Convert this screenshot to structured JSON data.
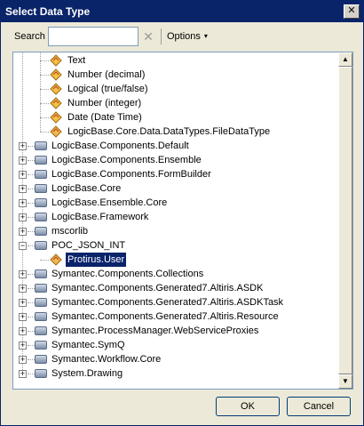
{
  "window": {
    "title": "Select Data Type",
    "close_glyph": "✕"
  },
  "toolbar": {
    "search_label": "Search",
    "search_value": "",
    "clear_icon": "clear-icon",
    "options_label": "Options",
    "options_caret": "▾"
  },
  "tree": {
    "expand_glyph": "+",
    "collapse_glyph": "−",
    "types": [
      {
        "label": "Text"
      },
      {
        "label": "Number (decimal)"
      },
      {
        "label": "Logical (true/false)"
      },
      {
        "label": "Number (integer)"
      },
      {
        "label": "Date (Date Time)"
      },
      {
        "label": "LogicBase.Core.Data.DataTypes.FileDataType"
      }
    ],
    "namespaces": [
      {
        "label": "LogicBase.Components.Default",
        "expanded": false
      },
      {
        "label": "LogicBase.Components.Ensemble",
        "expanded": false
      },
      {
        "label": "LogicBase.Components.FormBuilder",
        "expanded": false
      },
      {
        "label": "LogicBase.Core",
        "expanded": false
      },
      {
        "label": "LogicBase.Ensemble.Core",
        "expanded": false
      },
      {
        "label": "LogicBase.Framework",
        "expanded": false
      },
      {
        "label": "mscorlib",
        "expanded": false
      },
      {
        "label": "POC_JSON_INT",
        "expanded": true
      },
      {
        "label": "Symantec.Components.Collections",
        "expanded": false
      },
      {
        "label": "Symantec.Components.Generated7.Altiris.ASDK",
        "expanded": false
      },
      {
        "label": "Symantec.Components.Generated7.Altiris.ASDKTask",
        "expanded": false
      },
      {
        "label": "Symantec.Components.Generated7.Altiris.Resource",
        "expanded": false
      },
      {
        "label": "Symantec.ProcessManager.WebServiceProxies",
        "expanded": false
      },
      {
        "label": "Symantec.SymQ",
        "expanded": false
      },
      {
        "label": "Symantec.Workflow.Core",
        "expanded": false
      },
      {
        "label": "System.Drawing",
        "expanded": false
      }
    ],
    "poc_child": {
      "label": "Protirus.User",
      "selected": true
    }
  },
  "scrollbar": {
    "up_glyph": "▲",
    "down_glyph": "▼"
  },
  "buttons": {
    "ok": "OK",
    "cancel": "Cancel"
  }
}
